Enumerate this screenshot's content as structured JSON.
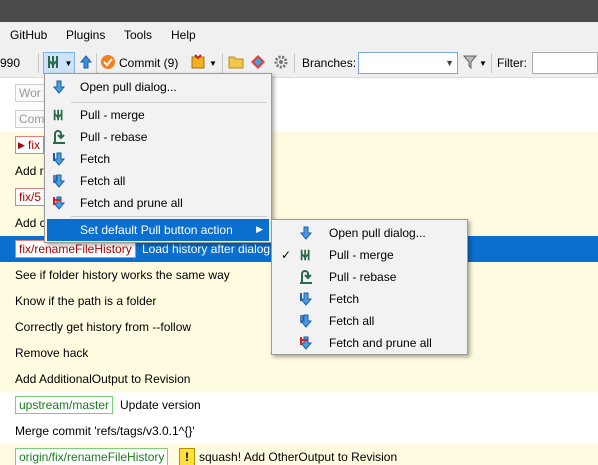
{
  "menubar": {
    "items": [
      "GitHub",
      "Plugins",
      "Tools",
      "Help"
    ]
  },
  "toolbar": {
    "left_fragment": "990",
    "commit_label": "Commit (9)",
    "branches_label": "Branches:",
    "branches_value": "",
    "filter_label": "Filter:",
    "filter_value": ""
  },
  "pull_menu": {
    "items": [
      {
        "label": "Open pull dialog...",
        "icon": "pull-dialog-icon"
      },
      {
        "label": "Pull - merge",
        "icon": "pull-merge-icon"
      },
      {
        "label": "Pull - rebase",
        "icon": "pull-rebase-icon"
      },
      {
        "label": "Fetch",
        "icon": "fetch-icon"
      },
      {
        "label": "Fetch all",
        "icon": "fetch-all-icon"
      },
      {
        "label": "Fetch and prune all",
        "icon": "fetch-prune-icon"
      },
      {
        "label": "Set default Pull button action",
        "icon": "",
        "submenu": true
      }
    ]
  },
  "default_submenu": {
    "items": [
      {
        "label": "Open pull dialog...",
        "checked": false
      },
      {
        "label": "Pull - merge",
        "checked": true
      },
      {
        "label": "Pull - rebase",
        "checked": false
      },
      {
        "label": "Fetch",
        "checked": false
      },
      {
        "label": "Fetch all",
        "checked": false
      },
      {
        "label": "Fetch and prune all",
        "checked": false
      }
    ],
    "check_mark": "✓"
  },
  "commits": [
    {
      "placeholder": "Wor"
    },
    {
      "placeholder": "Com"
    },
    {
      "tag": "fix",
      "message": ""
    },
    {
      "message": "Add r"
    },
    {
      "tag": "fix/5",
      "message": ""
    },
    {
      "message": "Add c"
    },
    {
      "tag": "fix/renameFileHistory",
      "message": "Load history after dialog"
    },
    {
      "message": "See if folder history works the same way"
    },
    {
      "message": "Know if the path is a folder"
    },
    {
      "message": "Correctly get history from --follow"
    },
    {
      "message": "Remove hack"
    },
    {
      "message": "Add AdditionalOutput to Revision"
    },
    {
      "tag": "upstream/master",
      "message": "Update version"
    },
    {
      "message": "Merge commit 'refs/tags/v3.0.1^{}'"
    },
    {
      "tag": "origin/fix/renameFileHistory",
      "warning": "!",
      "message": "squash! Add OtherOutput to Revision"
    }
  ],
  "colors": {
    "selection": "#0a6fcf",
    "row_highlight": "#fffbe0",
    "titlebar": "#4a4a4a"
  }
}
